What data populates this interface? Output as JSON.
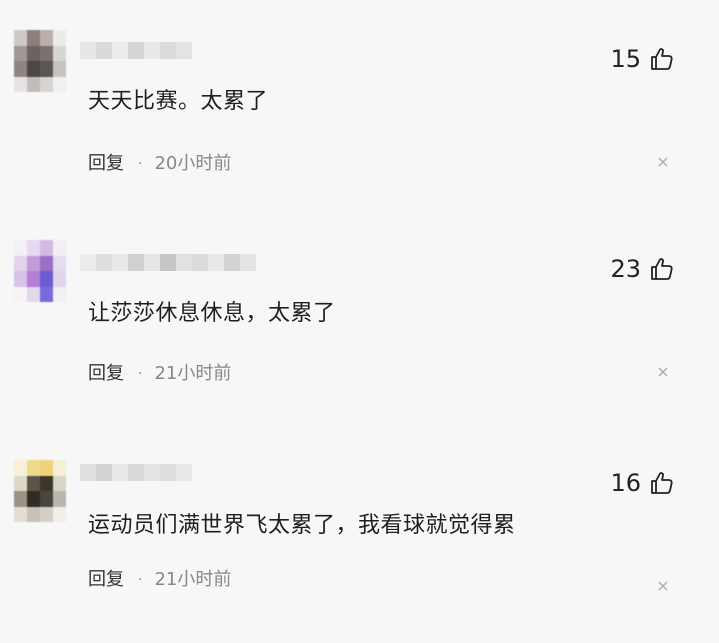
{
  "comments": [
    {
      "likes": "15",
      "text": "天天比赛。太累了",
      "reply_label": "回复",
      "separator": "·",
      "time": "20小时前",
      "like_icon": "thumbs-up-icon",
      "close_icon": "close-icon"
    },
    {
      "likes": "23",
      "text": "让莎莎休息休息，太累了",
      "reply_label": "回复",
      "separator": "·",
      "time": "21小时前",
      "like_icon": "thumbs-up-icon",
      "close_icon": "close-icon"
    },
    {
      "likes": "16",
      "text": "运动员们满世界飞太累了，我看球就觉得累",
      "reply_label": "回复",
      "separator": "·",
      "time": "21小时前",
      "like_icon": "thumbs-up-icon",
      "close_icon": "close-icon"
    }
  ]
}
